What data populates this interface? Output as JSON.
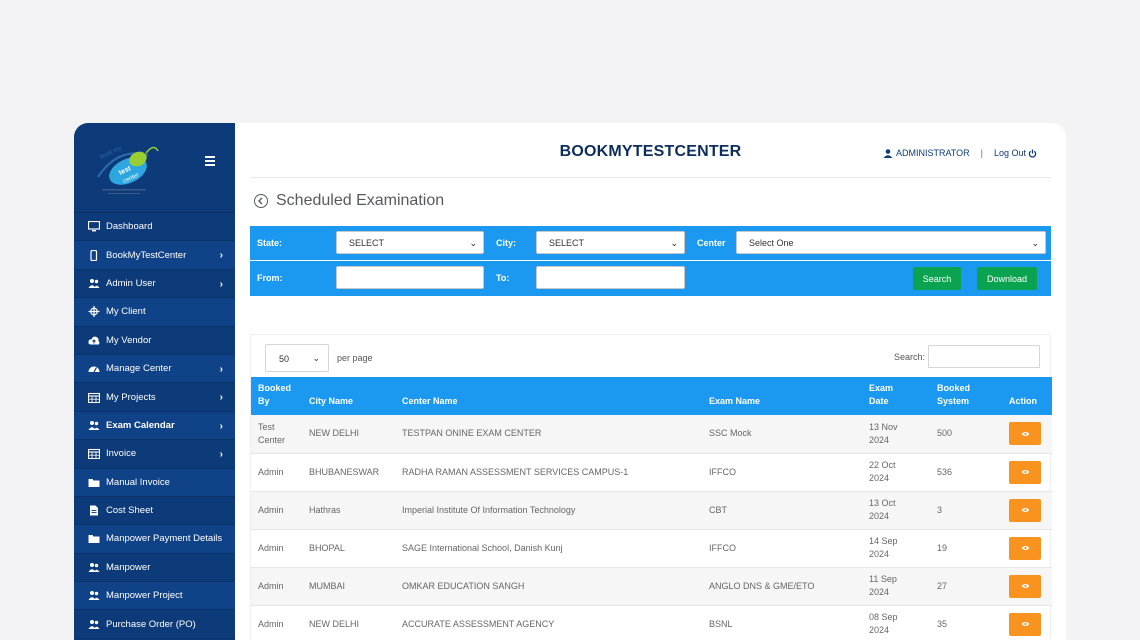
{
  "brand": {
    "title": "BOOKMYTESTCENTER",
    "logo_text": [
      "book my",
      "test",
      "center"
    ],
    "user": "ADMINISTRATOR",
    "separator": "|",
    "logout": "Log Out"
  },
  "sidebar": {
    "items": [
      {
        "label": "Dashboard",
        "icon": "monitor-icon",
        "chevron": false
      },
      {
        "label": "BookMyTestCenter",
        "icon": "mobile-icon",
        "chevron": true
      },
      {
        "label": "Admin User",
        "icon": "users-icon",
        "chevron": true
      },
      {
        "label": "My Client",
        "icon": "crosshair-icon",
        "chevron": false
      },
      {
        "label": "My Vendor",
        "icon": "cloud-upload-icon",
        "chevron": false
      },
      {
        "label": "Manage Center",
        "icon": "dashboard-icon",
        "chevron": true
      },
      {
        "label": "My Projects",
        "icon": "calendar-icon",
        "chevron": true
      },
      {
        "label": "Exam Calendar",
        "icon": "users-icon",
        "chevron": true
      },
      {
        "label": "Invoice",
        "icon": "calendar-icon",
        "chevron": true
      },
      {
        "label": "Manual Invoice",
        "icon": "folder-icon",
        "chevron": false
      },
      {
        "label": "Cost Sheet",
        "icon": "file-icon",
        "chevron": false
      },
      {
        "label": "Manpower Payment Details",
        "icon": "folder-icon",
        "chevron": false
      },
      {
        "label": "Manpower",
        "icon": "users-icon",
        "chevron": false
      },
      {
        "label": "Manpower Project",
        "icon": "users-icon",
        "chevron": false
      },
      {
        "label": "Purchase Order (PO)",
        "icon": "users-icon",
        "chevron": false
      }
    ],
    "chevron": "›"
  },
  "page": {
    "title": "Scheduled Examination"
  },
  "filters": {
    "state_label": "State:",
    "state_value": "SELECT",
    "city_label": "City:",
    "city_value": "SELECT",
    "center_label": "Center",
    "center_value": "Select One",
    "from_label": "From:",
    "to_label": "To:",
    "search_button": "Search",
    "download_button": "Download"
  },
  "table_controls": {
    "per_page_value": "50",
    "per_page_label": "per page",
    "search_label": "Search:"
  },
  "table": {
    "columns": {
      "booked_by": [
        "Booked",
        "By"
      ],
      "city": "City Name",
      "center": "Center Name",
      "exam": "Exam Name",
      "date": [
        "Exam",
        "Date"
      ],
      "system": [
        "Booked",
        "System"
      ],
      "action": "Action"
    },
    "rows": [
      {
        "booked_by": [
          "Test",
          "Center"
        ],
        "city": "NEW DELHI",
        "center": "TESTPAN ONINE EXAM CENTER",
        "exam": "SSC Mock",
        "date": [
          "13 Nov",
          "2024"
        ],
        "system": "500"
      },
      {
        "booked_by": [
          "Admin",
          ""
        ],
        "city": "BHUBANESWAR",
        "center": "RADHA RAMAN ASSESSMENT SERVICES CAMPUS-1",
        "exam": "IFFCO",
        "date": [
          "22 Oct",
          "2024"
        ],
        "system": "536"
      },
      {
        "booked_by": [
          "Admin",
          ""
        ],
        "city": "Hathras",
        "center": "Imperial Institute Of Information Technology",
        "exam": "CBT",
        "date": [
          "13 Oct",
          "2024"
        ],
        "system": "3"
      },
      {
        "booked_by": [
          "Admin",
          ""
        ],
        "city": "BHOPAL",
        "center": "SAGE International School, Danish Kunj",
        "exam": "IFFCO",
        "date": [
          "14 Sep",
          "2024"
        ],
        "system": "19"
      },
      {
        "booked_by": [
          "Admin",
          ""
        ],
        "city": "MUMBAI",
        "center": "OMKAR EDUCATION SANGH",
        "exam": "ANGLO DNS & GME/ETO",
        "date": [
          "11 Sep",
          "2024"
        ],
        "system": "27"
      },
      {
        "booked_by": [
          "Admin",
          ""
        ],
        "city": "NEW DELHI",
        "center": "ACCURATE ASSESSMENT AGENCY",
        "exam": "BSNL",
        "date": [
          "08 Sep",
          "2024"
        ],
        "system": "35"
      }
    ]
  },
  "colors": {
    "sidebar": "#0d3a78",
    "accent_blue": "#1b99f0",
    "green_button": "#0aa34f",
    "action_orange": "#f7931e"
  }
}
